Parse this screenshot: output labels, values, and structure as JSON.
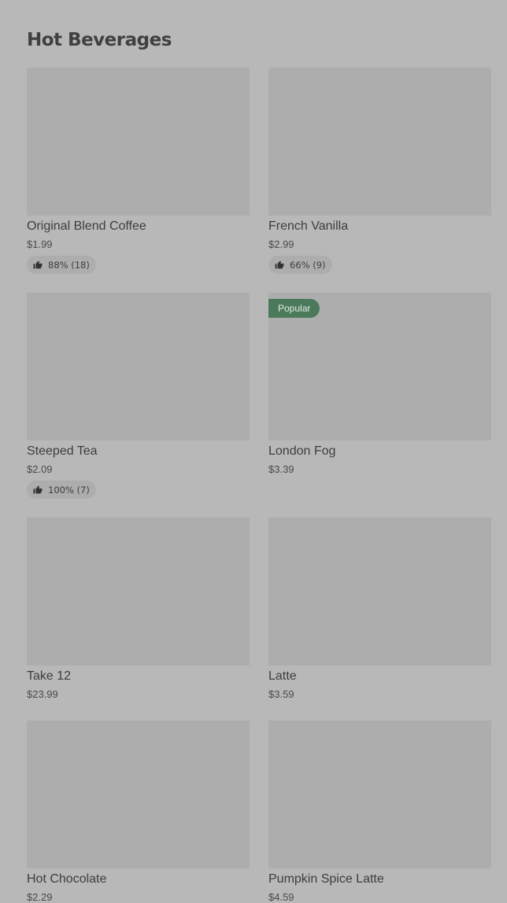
{
  "section": {
    "title": "Hot Beverages"
  },
  "products": [
    {
      "name": "Original Blend Coffee",
      "price": "$1.99",
      "rating": "88% (18)"
    },
    {
      "name": "French Vanilla",
      "price": "$2.99",
      "rating": "66% (9)"
    },
    {
      "name": "Steeped Tea",
      "price": "$2.09",
      "rating": "100% (7)"
    },
    {
      "name": "London Fog",
      "price": "$3.39",
      "badge": "Popular"
    },
    {
      "name": "Take 12",
      "price": "$23.99"
    },
    {
      "name": "Latte",
      "price": "$3.59"
    },
    {
      "name": "Hot Chocolate",
      "price": "$2.29"
    },
    {
      "name": "Pumpkin Spice Latte",
      "price": "$4.59"
    }
  ],
  "icons": {
    "rating": "thumbs-up-icon"
  }
}
